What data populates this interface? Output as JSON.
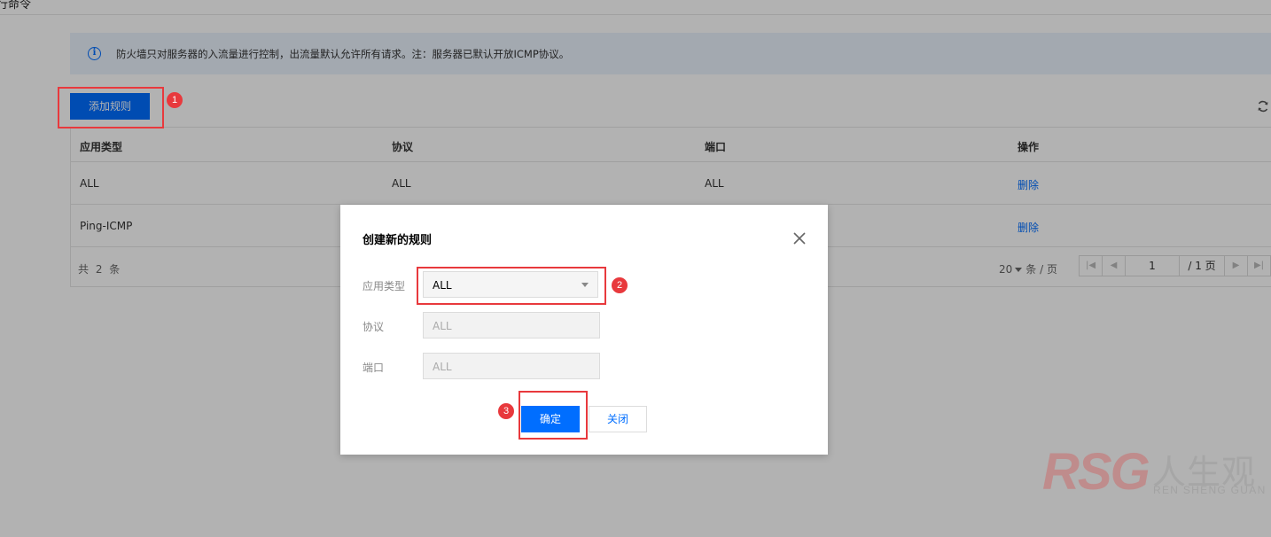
{
  "page": {
    "title_fragment": "行命令",
    "notice": "防火墙只对服务器的入流量进行控制，出流量默认允许所有请求。注：服务器已默认开放ICMP协议。",
    "add_rule_button": "添加规则"
  },
  "table": {
    "headers": [
      "应用类型",
      "协议",
      "端口",
      "操作"
    ],
    "rows": [
      {
        "app_type": "ALL",
        "protocol": "ALL",
        "port": "ALL",
        "action": "删除"
      },
      {
        "app_type": "Ping-ICMP",
        "protocol": "",
        "port": "",
        "action": "删除"
      }
    ],
    "total": "共 2 条",
    "page_size_value": "20",
    "page_size_unit": "条 / 页",
    "current_page": "1",
    "total_pages": "/ 1 页"
  },
  "modal": {
    "title": "创建新的规则",
    "app_type_label": "应用类型",
    "app_type_value": "ALL",
    "protocol_label": "协议",
    "protocol_value": "ALL",
    "port_label": "端口",
    "port_value": "ALL",
    "confirm_button": "确定",
    "cancel_button": "关闭"
  },
  "annotations": {
    "badge_1": "1",
    "badge_2": "2",
    "badge_3": "3",
    "highlight_color": "#e8393d"
  },
  "watermark": {
    "brand": "RSG",
    "chinese": "人生观",
    "pinyin": "REN SHENG GUAN"
  },
  "colors": {
    "primary": "#006eff",
    "notice_bg": "#eaf2fd",
    "overlay": "rgba(0,0,0,0.3)"
  },
  "icons": [
    "info-icon",
    "refresh-icon",
    "close-icon",
    "chevron-down-icon",
    "first-page-icon",
    "prev-page-icon",
    "next-page-icon",
    "last-page-icon"
  ]
}
